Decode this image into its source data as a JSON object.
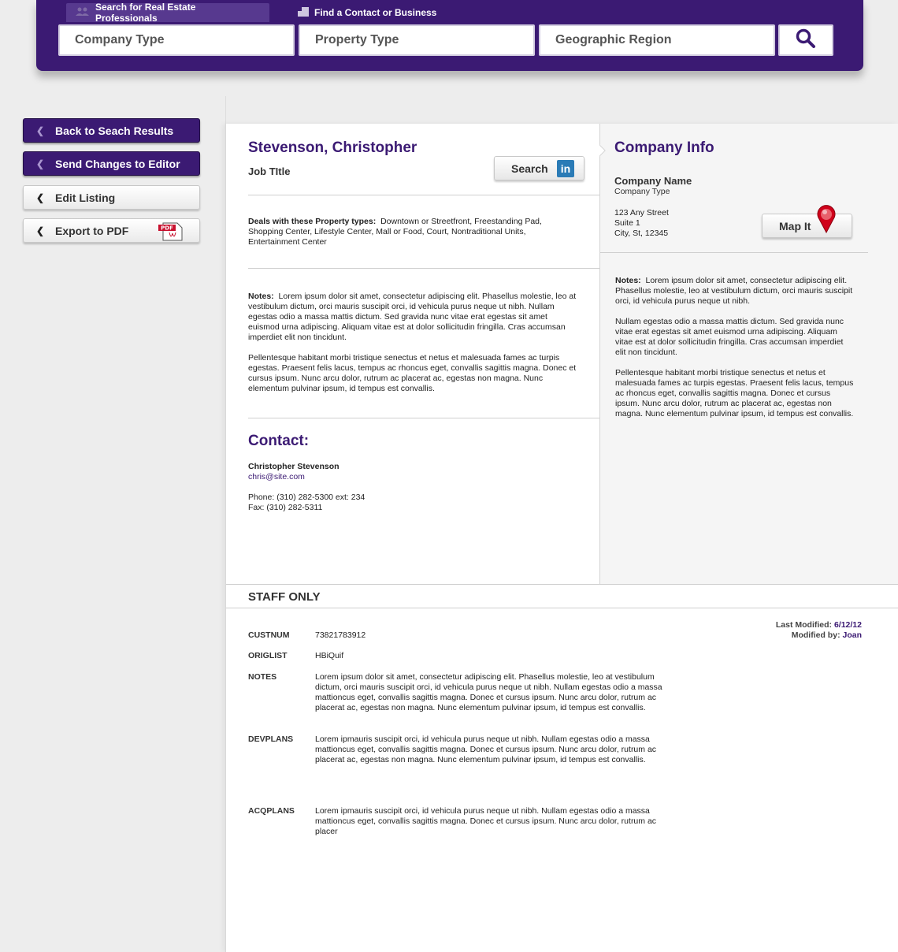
{
  "header": {
    "tab_pros": "Search for Real Estate Professionals",
    "tab_contact": "Find a Contact or Business",
    "company_type": "Company Type",
    "property_type": "Property Type",
    "geographic_region": "Geographic Region"
  },
  "sidebar": {
    "back": "Back to Seach Results",
    "send": "Send Changes to Editor",
    "edit": "Edit Listing",
    "export": "Export to PDF",
    "pdf_badge": "PDF"
  },
  "profile": {
    "name": "Stevenson, Christopher",
    "job_title": "Job TItle",
    "search_label": "Search",
    "linkedin": "in",
    "deals_label": "Deals with these Property types:",
    "deals_value": "Downtown or Streetfront, Freestanding Pad, Shopping Center, Lifestyle Center, Mall or Food, Court, Nontraditional Units, Entertainment Center",
    "notes_label": "Notes:",
    "notes_p1": "Lorem ipsum dolor sit amet, consectetur adipiscing elit. Phasellus molestie, leo at vestibulum dictum, orci mauris suscipit orci, id vehicula purus neque ut nibh. Nullam egestas odio a massa mattis dictum. Sed gravida nunc vitae erat egestas sit amet euismod urna adipiscing. Aliquam vitae est at dolor sollicitudin fringilla. Cras accumsan imperdiet elit non tincidunt.",
    "notes_p2": "Pellentesque habitant morbi tristique senectus et netus et malesuada fames ac turpis egestas. Praesent felis lacus, tempus ac rhoncus eget, convallis sagittis magna. Donec et cursus ipsum. Nunc arcu dolor, rutrum ac placerat ac, egestas non magna. Nunc elementum pulvinar ipsum, id tempus est convallis."
  },
  "contact": {
    "heading": "Contact:",
    "name": "Christopher Stevenson",
    "email": "chris@site.com",
    "phone": "Phone: (310) 282-5300 ext: 234",
    "fax": "Fax: (310) 282-5311"
  },
  "company": {
    "heading": "Company Info",
    "name": "Company Name",
    "type": "Company Type",
    "addr1": "123 Any Street",
    "addr2": "Suite 1",
    "addr3": "City, St, 12345",
    "map_label": "Map It",
    "notes_label": "Notes:",
    "notes_p1": "Lorem ipsum dolor sit amet, consectetur adipiscing elit. Phasellus molestie, leo at vestibulum dictum, orci mauris suscipit orci, id vehicula purus neque ut nibh.",
    "notes_p2": "Nullam egestas odio a massa mattis dictum. Sed gravida nunc vitae erat egestas sit amet euismod urna adipiscing. Aliquam vitae est at dolor sollicitudin fringilla. Cras accumsan imperdiet elit non tincidunt.",
    "notes_p3": "Pellentesque habitant morbi tristique senectus et netus et malesuada fames ac turpis egestas. Praesent felis lacus, tempus ac rhoncus eget, convallis sagittis magna. Donec et cursus ipsum. Nunc arcu dolor, rutrum ac placerat ac, egestas non magna. Nunc elementum pulvinar ipsum, id tempus est convallis."
  },
  "staff": {
    "heading": "STAFF ONLY",
    "last_modified_label": "Last Modified:",
    "last_modified_value": "6/12/12",
    "modified_by_label": "Modified by:",
    "modified_by_value": "Joan",
    "rows": [
      {
        "key": "CUSTNUM",
        "value": "73821783912"
      },
      {
        "key": "ORIGLIST",
        "value": "HBiQuif"
      },
      {
        "key": "NOTES",
        "value": "Lorem ipsum dolor sit amet, consectetur adipiscing elit. Phasellus molestie, leo at vestibulum dictum, orci mauris suscipit orci, id vehicula purus neque ut nibh. Nullam egestas odio a massa mattioncus eget, convallis sagittis magna. Donec et cursus ipsum. Nunc arcu dolor, rutrum ac placerat ac, egestas non magna. Nunc elementum pulvinar ipsum, id tempus est convallis."
      },
      {
        "key": "DEVPLANS",
        "value": "Lorem ipmauris suscipit orci, id vehicula purus neque ut nibh. Nullam egestas odio a massa mattioncus eget, convallis sagittis magna. Donec et cursus ipsum. Nunc arcu dolor, rutrum ac placerat ac, egestas non magna. Nunc elementum pulvinar ipsum, id tempus est convallis."
      },
      {
        "key": "ACQPLANS",
        "value": "Lorem ipmauris suscipit orci, id vehicula purus neque ut nibh. Nullam egestas odio a massa mattioncus eget, convallis sagittis magna. Donec et cursus ipsum. Nunc arcu dolor, rutrum ac placer"
      }
    ]
  },
  "colors": {
    "brand": "#3b1a73",
    "linkedin": "#2a7bb6",
    "pin": "#d0021b"
  },
  "icons": [
    "people-icon",
    "building-icon",
    "search-icon",
    "chevron-left-icon",
    "pdf-icon",
    "linkedin-icon",
    "map-pin-icon"
  ]
}
